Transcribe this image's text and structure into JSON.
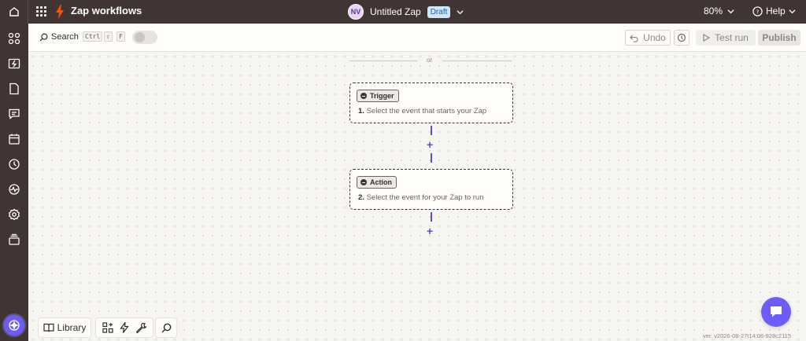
{
  "topbar": {
    "app_title": "Zap workflows",
    "avatar_initials": "NV",
    "zap_name": "Untitled Zap",
    "status_badge": "Draft",
    "zoom_level": "80%",
    "help_label": "Help"
  },
  "sidebar": {
    "items": [
      "apps-icon",
      "zaps-icon",
      "tables-icon",
      "interfaces-icon",
      "canvas-icon",
      "history-icon",
      "activity-icon",
      "settings-icon",
      "archive-icon"
    ]
  },
  "toolbar": {
    "search_label": "Search",
    "shortcut_keys": [
      "Ctrl",
      "⇧",
      "F"
    ],
    "undo_label": "Undo",
    "test_run_label": "Test run",
    "publish_label": "Publish"
  },
  "canvas": {
    "or_text": "or",
    "steps": [
      {
        "tag": "Trigger",
        "number": "1.",
        "description": "Select the event that starts your Zap"
      },
      {
        "tag": "Action",
        "number": "2.",
        "description": "Select the event for your Zap to run"
      }
    ]
  },
  "bottom": {
    "library_label": "Library"
  },
  "version_text": "ver. v2026-08-27t14:06-928c2115",
  "colors": {
    "topbar_bg": "#403533",
    "accent": "#6e5cf6",
    "connector": "#5a4fcf",
    "zap_orange": "#ff4f00",
    "draft_badge_bg": "#cfe6fb"
  }
}
